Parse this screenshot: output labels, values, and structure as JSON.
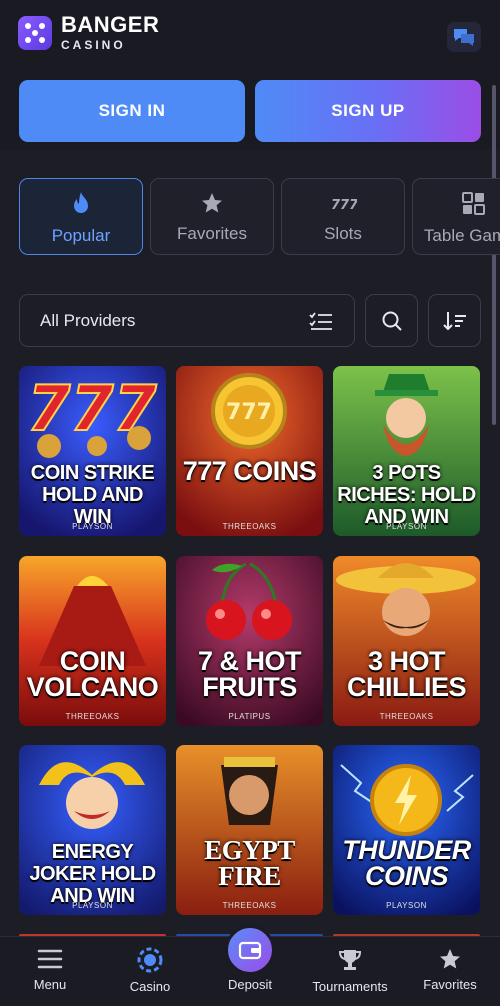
{
  "header": {
    "brand": "BANGER",
    "brand_sub": "CASINO",
    "sign_in": "SIGN IN",
    "sign_up": "SIGN UP",
    "chat_icon": "chat-icon"
  },
  "tabs": [
    {
      "label": "Popular",
      "icon": "flame-icon",
      "active": true
    },
    {
      "label": "Favorites",
      "icon": "star-icon",
      "active": false
    },
    {
      "label": "Slots",
      "icon": "777-icon",
      "active": false
    },
    {
      "label": "Table Games",
      "icon": "table-games-icon",
      "active": false
    }
  ],
  "filters": {
    "providers_label": "All Providers",
    "search_icon": "search-icon",
    "sort_icon": "sort-icon"
  },
  "games": [
    {
      "title": "COIN STRIKE HOLD AND WIN",
      "provider": "PLAYSON"
    },
    {
      "title": "777 COINS",
      "provider": "THREEOAKS"
    },
    {
      "title": "3 POTS RICHES: HOLD AND WIN",
      "provider": "PLAYSON"
    },
    {
      "title": "COIN VOLCANO",
      "provider": "THREEOAKS"
    },
    {
      "title": "7 & HOT FRUITS",
      "provider": "PLATIPUS"
    },
    {
      "title": "3 HOT CHILLIES",
      "provider": "THREEOAKS"
    },
    {
      "title": "ENERGY JOKER HOLD AND WIN",
      "provider": "PLAYSON"
    },
    {
      "title": "EGYPT FIRE",
      "provider": "THREEOAKS"
    },
    {
      "title": "THUNDER COINS",
      "provider": "PLAYSON"
    }
  ],
  "bottom_nav": [
    {
      "label": "Menu",
      "icon": "menu-icon"
    },
    {
      "label": "Casino",
      "icon": "casino-chip-icon"
    },
    {
      "label": "Deposit",
      "icon": "wallet-icon"
    },
    {
      "label": "Tournaments",
      "icon": "trophy-icon"
    },
    {
      "label": "Favorites",
      "icon": "star-icon"
    }
  ],
  "colors": {
    "background": "#1c1d25",
    "accent_blue": "#4f8bf6",
    "accent_purple": "#9b4de6"
  }
}
